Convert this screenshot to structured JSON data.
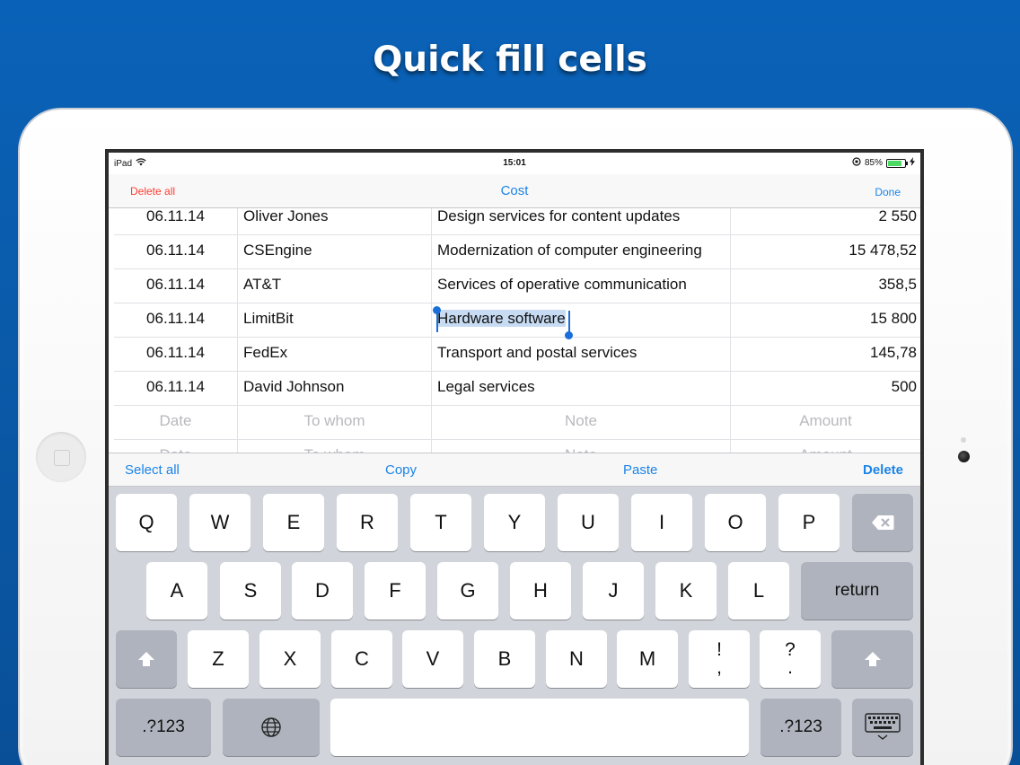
{
  "promo": {
    "title": "Quick fill cells"
  },
  "status_bar": {
    "device": "iPad",
    "time": "15:01",
    "battery": "85%",
    "battery_level": 0.85
  },
  "nav": {
    "left": "Delete all",
    "title": "Cost",
    "right": "Done"
  },
  "rows": [
    {
      "date": "06.11.14",
      "to_whom": "Oliver Jones",
      "note": "Design services for content updates",
      "amount": "2 550"
    },
    {
      "date": "06.11.14",
      "to_whom": "CSEngine",
      "note": "Modernization of computer engineering",
      "amount": "15 478,52"
    },
    {
      "date": "06.11.14",
      "to_whom": "AT&T",
      "note": "Services of operative communication",
      "amount": "358,5"
    },
    {
      "date": "06.11.14",
      "to_whom": "LimitBit",
      "note": "Hardware software",
      "amount": "15 800"
    },
    {
      "date": "06.11.14",
      "to_whom": "FedEx",
      "note": "Transport and postal services",
      "amount": "145,78"
    },
    {
      "date": "06.11.14",
      "to_whom": "David Johnson",
      "note": "Legal services",
      "amount": "500"
    }
  ],
  "placeholders": {
    "date": "Date",
    "to_whom": "To whom",
    "note": "Note",
    "amount": "Amount"
  },
  "edit_menu": {
    "select_all": "Select all",
    "copy": "Copy",
    "paste": "Paste",
    "delete": "Delete"
  },
  "keyboard": {
    "row1": [
      "Q",
      "W",
      "E",
      "R",
      "T",
      "Y",
      "U",
      "I",
      "O",
      "P"
    ],
    "row2": [
      "A",
      "S",
      "D",
      "F",
      "G",
      "H",
      "J",
      "K",
      "L"
    ],
    "row3": [
      "Z",
      "X",
      "C",
      "V",
      "B",
      "N",
      "M"
    ],
    "return_label": "return",
    "excl_top": "!",
    "excl_bottom": ",",
    "quest_top": "?",
    "quest_bottom": ".",
    "numbers_label": ".?123"
  },
  "colors": {
    "accent": "#1a84e8",
    "destructive": "#ff3b30",
    "background": "#0a5aa9"
  }
}
